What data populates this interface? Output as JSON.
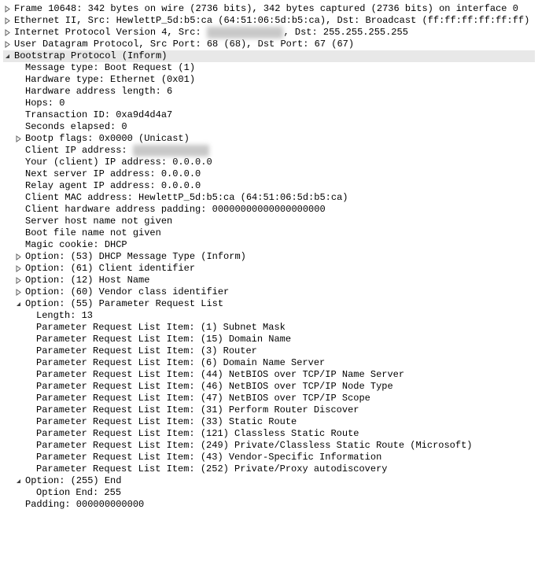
{
  "rows": [
    {
      "indent": 0,
      "toggle": "collapsed",
      "hl": false,
      "text": "Frame 10648: 342 bytes on wire (2736 bits), 342 bytes captured (2736 bits) on interface 0"
    },
    {
      "indent": 0,
      "toggle": "collapsed",
      "hl": false,
      "text": "Ethernet II, Src: HewlettP_5d:b5:ca (64:51:06:5d:b5:ca), Dst: Broadcast (ff:ff:ff:ff:ff:ff)"
    },
    {
      "indent": 0,
      "toggle": "collapsed",
      "hl": false,
      "text": "Internet Protocol Version 4, Src: ",
      "blur": "XXX.X.XXX.XXX",
      "after": ", Dst: 255.255.255.255"
    },
    {
      "indent": 0,
      "toggle": "collapsed",
      "hl": false,
      "text": "User Datagram Protocol, Src Port: 68 (68), Dst Port: 67 (67)"
    },
    {
      "indent": 0,
      "toggle": "expanded",
      "hl": true,
      "text": "Bootstrap Protocol (Inform)"
    },
    {
      "indent": 1,
      "toggle": "none",
      "hl": false,
      "text": "Message type: Boot Request (1)"
    },
    {
      "indent": 1,
      "toggle": "none",
      "hl": false,
      "text": "Hardware type: Ethernet (0x01)"
    },
    {
      "indent": 1,
      "toggle": "none",
      "hl": false,
      "text": "Hardware address length: 6"
    },
    {
      "indent": 1,
      "toggle": "none",
      "hl": false,
      "text": "Hops: 0"
    },
    {
      "indent": 1,
      "toggle": "none",
      "hl": false,
      "text": "Transaction ID: 0xa9d4d4a7"
    },
    {
      "indent": 1,
      "toggle": "none",
      "hl": false,
      "text": "Seconds elapsed: 0"
    },
    {
      "indent": 1,
      "toggle": "collapsed",
      "hl": false,
      "text": "Bootp flags: 0x0000 (Unicast)"
    },
    {
      "indent": 1,
      "toggle": "none",
      "hl": false,
      "text": "Client IP address: ",
      "blur": "XXX.X.XXX.XXX",
      "after": ""
    },
    {
      "indent": 1,
      "toggle": "none",
      "hl": false,
      "text": "Your (client) IP address: 0.0.0.0"
    },
    {
      "indent": 1,
      "toggle": "none",
      "hl": false,
      "text": "Next server IP address: 0.0.0.0"
    },
    {
      "indent": 1,
      "toggle": "none",
      "hl": false,
      "text": "Relay agent IP address: 0.0.0.0"
    },
    {
      "indent": 1,
      "toggle": "none",
      "hl": false,
      "text": "Client MAC address: HewlettP_5d:b5:ca (64:51:06:5d:b5:ca)"
    },
    {
      "indent": 1,
      "toggle": "none",
      "hl": false,
      "text": "Client hardware address padding: 00000000000000000000"
    },
    {
      "indent": 1,
      "toggle": "none",
      "hl": false,
      "text": "Server host name not given"
    },
    {
      "indent": 1,
      "toggle": "none",
      "hl": false,
      "text": "Boot file name not given"
    },
    {
      "indent": 1,
      "toggle": "none",
      "hl": false,
      "text": "Magic cookie: DHCP"
    },
    {
      "indent": 1,
      "toggle": "collapsed",
      "hl": false,
      "text": "Option: (53) DHCP Message Type (Inform)"
    },
    {
      "indent": 1,
      "toggle": "collapsed",
      "hl": false,
      "text": "Option: (61) Client identifier"
    },
    {
      "indent": 1,
      "toggle": "collapsed",
      "hl": false,
      "text": "Option: (12) Host Name"
    },
    {
      "indent": 1,
      "toggle": "collapsed",
      "hl": false,
      "text": "Option: (60) Vendor class identifier"
    },
    {
      "indent": 1,
      "toggle": "expanded",
      "hl": false,
      "text": "Option: (55) Parameter Request List"
    },
    {
      "indent": 2,
      "toggle": "none",
      "hl": false,
      "text": "Length: 13"
    },
    {
      "indent": 2,
      "toggle": "none",
      "hl": false,
      "text": "Parameter Request List Item: (1) Subnet Mask"
    },
    {
      "indent": 2,
      "toggle": "none",
      "hl": false,
      "text": "Parameter Request List Item: (15) Domain Name"
    },
    {
      "indent": 2,
      "toggle": "none",
      "hl": false,
      "text": "Parameter Request List Item: (3) Router"
    },
    {
      "indent": 2,
      "toggle": "none",
      "hl": false,
      "text": "Parameter Request List Item: (6) Domain Name Server"
    },
    {
      "indent": 2,
      "toggle": "none",
      "hl": false,
      "text": "Parameter Request List Item: (44) NetBIOS over TCP/IP Name Server"
    },
    {
      "indent": 2,
      "toggle": "none",
      "hl": false,
      "text": "Parameter Request List Item: (46) NetBIOS over TCP/IP Node Type"
    },
    {
      "indent": 2,
      "toggle": "none",
      "hl": false,
      "text": "Parameter Request List Item: (47) NetBIOS over TCP/IP Scope"
    },
    {
      "indent": 2,
      "toggle": "none",
      "hl": false,
      "text": "Parameter Request List Item: (31) Perform Router Discover"
    },
    {
      "indent": 2,
      "toggle": "none",
      "hl": false,
      "text": "Parameter Request List Item: (33) Static Route"
    },
    {
      "indent": 2,
      "toggle": "none",
      "hl": false,
      "text": "Parameter Request List Item: (121) Classless Static Route"
    },
    {
      "indent": 2,
      "toggle": "none",
      "hl": false,
      "text": "Parameter Request List Item: (249) Private/Classless Static Route (Microsoft)"
    },
    {
      "indent": 2,
      "toggle": "none",
      "hl": false,
      "text": "Parameter Request List Item: (43) Vendor-Specific Information"
    },
    {
      "indent": 2,
      "toggle": "none",
      "hl": false,
      "text": "Parameter Request List Item: (252) Private/Proxy autodiscovery"
    },
    {
      "indent": 1,
      "toggle": "expanded",
      "hl": false,
      "text": "Option: (255) End"
    },
    {
      "indent": 2,
      "toggle": "none",
      "hl": false,
      "text": "Option End: 255"
    },
    {
      "indent": 1,
      "toggle": "none",
      "hl": false,
      "text": "Padding: 000000000000"
    }
  ]
}
